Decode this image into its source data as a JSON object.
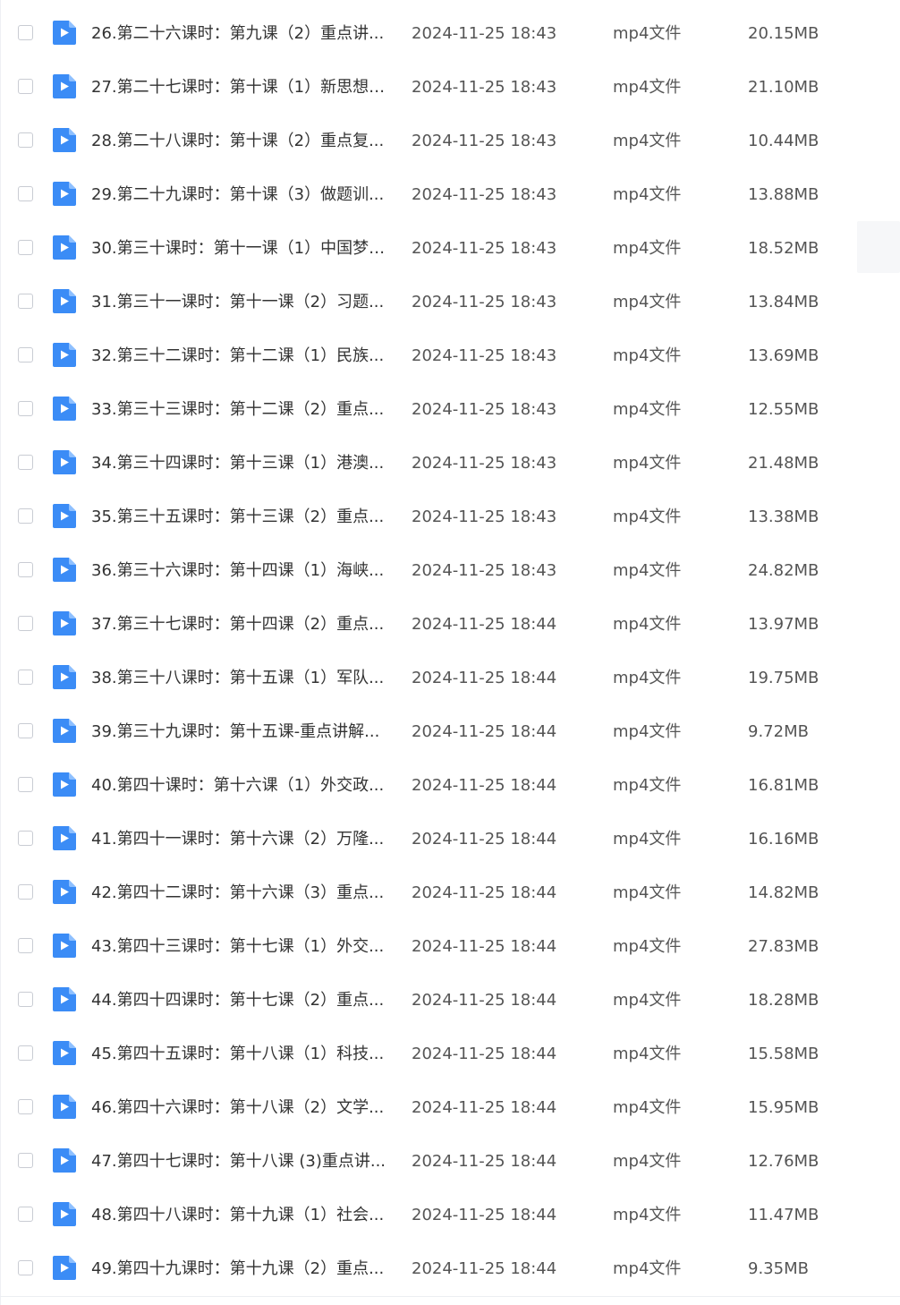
{
  "files": [
    {
      "name": "26.第二十六课时：第九课（2）重点讲...",
      "modified": "2024-11-25 18:43",
      "type": "mp4文件",
      "size": "20.15MB",
      "icon": "video-file-icon"
    },
    {
      "name": "27.第二十七课时：第十课（1）新思想(...",
      "modified": "2024-11-25 18:43",
      "type": "mp4文件",
      "size": "21.10MB",
      "icon": "video-file-icon"
    },
    {
      "name": "28.第二十八课时：第十课（2）重点复...",
      "modified": "2024-11-25 18:43",
      "type": "mp4文件",
      "size": "10.44MB",
      "icon": "video-file-icon"
    },
    {
      "name": "29.第二十九课时：第十课（3）做题训...",
      "modified": "2024-11-25 18:43",
      "type": "mp4文件",
      "size": "13.88MB",
      "icon": "video-file-icon"
    },
    {
      "name": "30.第三十课时：第十一课（1）中国梦(...",
      "modified": "2024-11-25 18:43",
      "type": "mp4文件",
      "size": "18.52MB",
      "icon": "video-file-icon"
    },
    {
      "name": "31.第三十一课时：第十一课（2）习题...",
      "modified": "2024-11-25 18:43",
      "type": "mp4文件",
      "size": "13.84MB",
      "icon": "video-file-icon"
    },
    {
      "name": "32.第三十二课时：第十二课（1）民族...",
      "modified": "2024-11-25 18:43",
      "type": "mp4文件",
      "size": "13.69MB",
      "icon": "video-file-icon"
    },
    {
      "name": "33.第三十三课时：第十二课（2）重点...",
      "modified": "2024-11-25 18:43",
      "type": "mp4文件",
      "size": "12.55MB",
      "icon": "video-file-icon"
    },
    {
      "name": "34.第三十四课时：第十三课（1）港澳...",
      "modified": "2024-11-25 18:43",
      "type": "mp4文件",
      "size": "21.48MB",
      "icon": "video-file-icon"
    },
    {
      "name": "35.第三十五课时：第十三课（2）重点...",
      "modified": "2024-11-25 18:43",
      "type": "mp4文件",
      "size": "13.38MB",
      "icon": "video-file-icon"
    },
    {
      "name": "36.第三十六课时：第十四课（1）海峡...",
      "modified": "2024-11-25 18:43",
      "type": "mp4文件",
      "size": "24.82MB",
      "icon": "video-file-icon"
    },
    {
      "name": "37.第三十七课时：第十四课（2）重点...",
      "modified": "2024-11-25 18:44",
      "type": "mp4文件",
      "size": "13.97MB",
      "icon": "video-file-icon"
    },
    {
      "name": "38.第三十八课时：第十五课（1）军队...",
      "modified": "2024-11-25 18:44",
      "type": "mp4文件",
      "size": "19.75MB",
      "icon": "video-file-icon"
    },
    {
      "name": "39.第三十九课时：第十五课-重点讲解...",
      "modified": "2024-11-25 18:44",
      "type": "mp4文件",
      "size": "9.72MB",
      "icon": "video-file-icon"
    },
    {
      "name": "40.第四十课时：第十六课（1）外交政...",
      "modified": "2024-11-25 18:44",
      "type": "mp4文件",
      "size": "16.81MB",
      "icon": "video-file-icon"
    },
    {
      "name": "41.第四十一课时：第十六课（2）万隆...",
      "modified": "2024-11-25 18:44",
      "type": "mp4文件",
      "size": "16.16MB",
      "icon": "video-file-icon"
    },
    {
      "name": "42.第四十二课时：第十六课（3）重点...",
      "modified": "2024-11-25 18:44",
      "type": "mp4文件",
      "size": "14.82MB",
      "icon": "video-file-icon"
    },
    {
      "name": "43.第四十三课时：第十七课（1）外交...",
      "modified": "2024-11-25 18:44",
      "type": "mp4文件",
      "size": "27.83MB",
      "icon": "video-file-icon"
    },
    {
      "name": "44.第四十四课时：第十七课（2）重点...",
      "modified": "2024-11-25 18:44",
      "type": "mp4文件",
      "size": "18.28MB",
      "icon": "video-file-icon"
    },
    {
      "name": "45.第四十五课时：第十八课（1）科技...",
      "modified": "2024-11-25 18:44",
      "type": "mp4文件",
      "size": "15.58MB",
      "icon": "video-file-icon"
    },
    {
      "name": "46.第四十六课时：第十八课（2）文学...",
      "modified": "2024-11-25 18:44",
      "type": "mp4文件",
      "size": "15.95MB",
      "icon": "video-file-icon"
    },
    {
      "name": "47.第四十七课时：第十八课 (3)重点讲...",
      "modified": "2024-11-25 18:44",
      "type": "mp4文件",
      "size": "12.76MB",
      "icon": "video-file-icon"
    },
    {
      "name": "48.第四十八课时：第十九课（1）社会...",
      "modified": "2024-11-25 18:44",
      "type": "mp4文件",
      "size": "11.47MB",
      "icon": "video-file-icon"
    },
    {
      "name": "49.第四十九课时：第十九课（2）重点...",
      "modified": "2024-11-25 18:44",
      "type": "mp4文件",
      "size": "9.35MB",
      "icon": "video-file-icon"
    }
  ],
  "colors": {
    "icon_blue": "#3b8cf6",
    "text_primary": "#333333",
    "text_secondary": "#555555",
    "checkbox_border": "#c9ccd3"
  }
}
